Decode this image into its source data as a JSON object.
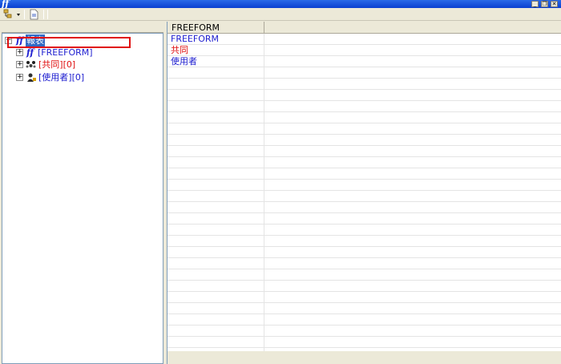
{
  "window": {
    "app_glyph": "ff",
    "buttons": [
      "_",
      "❐",
      "✕"
    ]
  },
  "toolbar": {
    "items": [
      "tree-view-icon",
      "dropdown-arrow-icon",
      "document-icon"
    ]
  },
  "tree": {
    "root": {
      "icon": "ff",
      "label": "報表"
    },
    "children": [
      {
        "icon": "ff",
        "label": "[FREEFORM]",
        "color": "#2020d0"
      },
      {
        "icon": "group-icon",
        "label": "[共同][0]",
        "color": "#e01010"
      },
      {
        "icon": "user-icon",
        "label": "[使用者][0]",
        "color": "#2020d0"
      }
    ]
  },
  "list": {
    "column": "FREEFORM",
    "rows": [
      {
        "text": "FREEFORM",
        "color": "#2020d0"
      },
      {
        "text": "共同",
        "color": "#e01010"
      },
      {
        "text": "使用者",
        "color": "#2020d0"
      }
    ]
  }
}
